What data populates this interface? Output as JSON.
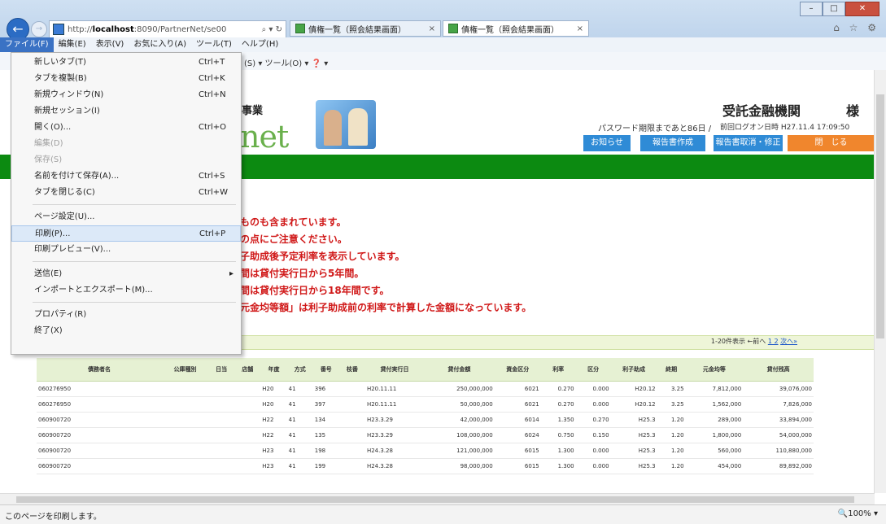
{
  "browser": {
    "address_prefix": "http://",
    "address_host": "localhost",
    "address_rest": ":8090/PartnerNet/se00",
    "address_controls": "⌕ ▾ ↻",
    "tabs": [
      {
        "label": "債権一覧（照会結果画面）",
        "close": "×"
      },
      {
        "label": "債権一覧（照会結果画面）",
        "close": "×"
      }
    ],
    "window_buttons": {
      "minimize": "–",
      "maximize": "□",
      "close": "✕"
    },
    "right_icons": "⌂ ☆ ⚙",
    "back": "←",
    "forward": "→"
  },
  "menubar": {
    "items": [
      "ファイル(F)",
      "編集(E)",
      "表示(V)",
      "お気に入り(A)",
      "ツール(T)",
      "ヘルプ(H)"
    ]
  },
  "command_bar": {
    "text": "(S) ▾  ツール(O) ▾  ❓ ▾"
  },
  "file_menu": {
    "items": [
      {
        "label": "新しいタブ(T)",
        "shortcut": "Ctrl+T"
      },
      {
        "label": "タブを複製(B)",
        "shortcut": "Ctrl+K"
      },
      {
        "label": "新規ウィンドウ(N)",
        "shortcut": "Ctrl+N"
      },
      {
        "label": "新規セッション(I)",
        "shortcut": ""
      },
      {
        "label": "開く(O)...",
        "shortcut": "Ctrl+O"
      },
      {
        "label": "編集(D)",
        "shortcut": ""
      },
      {
        "label": "保存(S)",
        "shortcut": ""
      },
      {
        "label": "名前を付けて保存(A)...",
        "shortcut": "Ctrl+S"
      },
      {
        "label": "タブを閉じる(C)",
        "shortcut": "Ctrl+W"
      },
      {
        "label": "ページ設定(U)...",
        "shortcut": ""
      },
      {
        "label": "印刷(P)...",
        "shortcut": "Ctrl+P"
      },
      {
        "label": "印刷プレビュー(V)...",
        "shortcut": ""
      },
      {
        "label": "送信(E)",
        "shortcut": ""
      },
      {
        "label": "インポートとエクスポート(M)...",
        "shortcut": ""
      },
      {
        "label": "プロパティ(R)",
        "shortcut": ""
      },
      {
        "label": "終了(X)",
        "shortcut": ""
      }
    ],
    "submenu_arrow": "▸"
  },
  "header": {
    "biz_text": "事業",
    "logo_text": "net",
    "bank_title": "受託金融機関",
    "sama": "様",
    "password_info": "パスワード期限まであと86日 /",
    "last_login": "前回ログオン日時 H27.11.4 17:09:50"
  },
  "nav": {
    "notice": "お知らせ",
    "report_create": "報告書作成",
    "report_fix": "報告書取消・修正",
    "logout": "閉　じる"
  },
  "notes": [
    "ものも含まれています。",
    "の点にご注意ください。",
    "子助成後予定利率を表示しています。",
    "間は貸付実行日から5年間。",
    "間は貸付実行日から18年間です。",
    "元金均等額」は利子助成前の利率で計算した金額になっています。"
  ],
  "pager": {
    "range": "1-20件表示 ←前へ",
    "pages": "1 2",
    "next": "次へ»"
  },
  "table": {
    "headers": [
      "債務者名",
      "公庫種別",
      "日当",
      "店舗",
      "年度",
      "方式",
      "番号",
      "枝番",
      "貸付実行日",
      "貸付金額",
      "資金区分",
      "利率",
      "区分",
      "利子助成",
      "終期",
      "元金均等",
      "貸付残高"
    ],
    "rows": [
      [
        "060276950",
        "",
        "",
        "",
        "H20",
        "41",
        "396",
        "",
        "H20.11.11",
        "250,000,000",
        "6021",
        "0.270",
        "0.000",
        "H20.12",
        "3.25",
        "7,812,000",
        "39,076,000"
      ],
      [
        "060276950",
        "",
        "",
        "",
        "H20",
        "41",
        "397",
        "",
        "H20.11.11",
        "50,000,000",
        "6021",
        "0.270",
        "0.000",
        "H20.12",
        "3.25",
        "1,562,000",
        "7,826,000"
      ],
      [
        "060900720",
        "",
        "",
        "",
        "H22",
        "41",
        "134",
        "",
        "H23.3.29",
        "42,000,000",
        "6014",
        "1.350",
        "0.270",
        "H25.3",
        "1.20",
        "289,000",
        "33,894,000"
      ],
      [
        "060900720",
        "",
        "",
        "",
        "H22",
        "41",
        "135",
        "",
        "H23.3.29",
        "108,000,000",
        "6024",
        "0.750",
        "0.150",
        "H25.3",
        "1.20",
        "1,800,000",
        "54,000,000"
      ],
      [
        "060900720",
        "",
        "",
        "",
        "H23",
        "41",
        "198",
        "",
        "H24.3.28",
        "121,000,000",
        "6015",
        "1.300",
        "0.000",
        "H25.3",
        "1.20",
        "560,000",
        "110,880,000"
      ],
      [
        "060900720",
        "",
        "",
        "",
        "H23",
        "41",
        "199",
        "",
        "H24.3.28",
        "98,000,000",
        "6015",
        "1.300",
        "0.000",
        "H25.3",
        "1.20",
        "454,000",
        "89,892,000"
      ]
    ]
  },
  "status": {
    "text": "このページを印刷します。",
    "zoom": "🔍100%  ▾"
  }
}
